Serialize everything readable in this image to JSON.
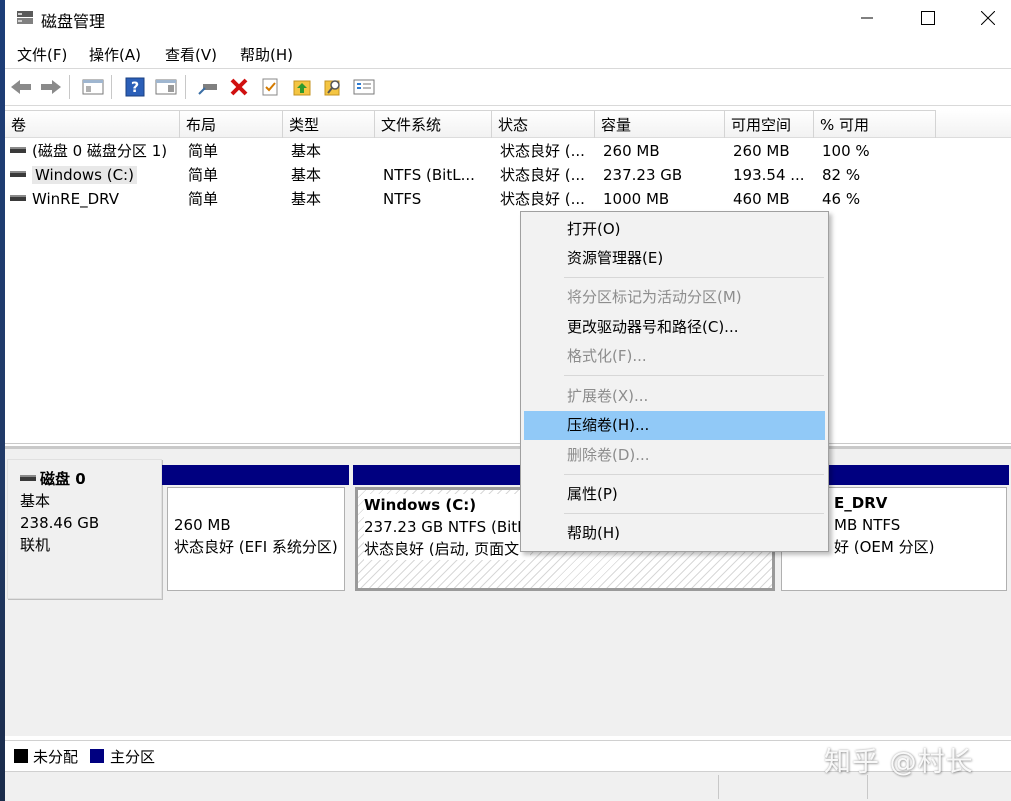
{
  "window": {
    "title": "磁盘管理",
    "minimize": "—",
    "maximize": "☐",
    "close": "✕"
  },
  "menu": [
    "文件(F)",
    "操作(A)",
    "查看(V)",
    "帮助(H)"
  ],
  "toolbar": {
    "icons": [
      "back-icon",
      "forward-icon",
      "console-icon",
      "help-icon",
      "properties-icon",
      "connect-icon",
      "delete-icon",
      "check-icon",
      "up-icon",
      "search-icon",
      "list-icon"
    ]
  },
  "table": {
    "headers": [
      "卷",
      "布局",
      "类型",
      "文件系统",
      "状态",
      "容量",
      "可用空间",
      "% 可用"
    ],
    "rows": [
      [
        "(磁盘 0 磁盘分区 1)",
        "简单",
        "基本",
        "",
        "状态良好 (...",
        "260 MB",
        "260 MB",
        "100 %"
      ],
      [
        "Windows (C:)",
        "简单",
        "基本",
        "NTFS (BitL...",
        "状态良好 (...",
        "237.23 GB",
        "193.54 ...",
        "82 %"
      ],
      [
        "WinRE_DRV",
        "简单",
        "基本",
        "NTFS",
        "状态良好 (...",
        "1000 MB",
        "460 MB",
        "46 %"
      ]
    ]
  },
  "disk": {
    "name": "磁盘 0",
    "type": "基本",
    "size": "238.46 GB",
    "status": "联机"
  },
  "partitions": [
    {
      "name": "",
      "line1": "260 MB",
      "line2": "状态良好 (EFI 系统分区)"
    },
    {
      "name": "Windows  (C:)",
      "line1": "237.23 GB NTFS (BitL",
      "line2": "状态良好 (启动, 页面文"
    },
    {
      "name": "E_DRV",
      "line1": "MB NTFS",
      "line2": "好 (OEM 分区)"
    }
  ],
  "context_menu": {
    "items": [
      {
        "label": "打开(O)",
        "enabled": true
      },
      {
        "label": "资源管理器(E)",
        "enabled": true
      },
      {
        "label": "将分区标记为活动分区(M)",
        "enabled": false
      },
      {
        "label": "更改驱动器号和路径(C)...",
        "enabled": true
      },
      {
        "label": "格式化(F)...",
        "enabled": false
      },
      {
        "label": "扩展卷(X)...",
        "enabled": false
      },
      {
        "label": "压缩卷(H)...",
        "enabled": true,
        "highlighted": true
      },
      {
        "label": "删除卷(D)...",
        "enabled": false
      },
      {
        "label": "属性(P)",
        "enabled": true
      },
      {
        "label": "帮助(H)",
        "enabled": true
      }
    ]
  },
  "legend": {
    "unallocated": "未分配",
    "primary": "主分区",
    "unallocated_color": "#000000",
    "primary_color": "#000080"
  },
  "watermark": "知乎 @村长"
}
